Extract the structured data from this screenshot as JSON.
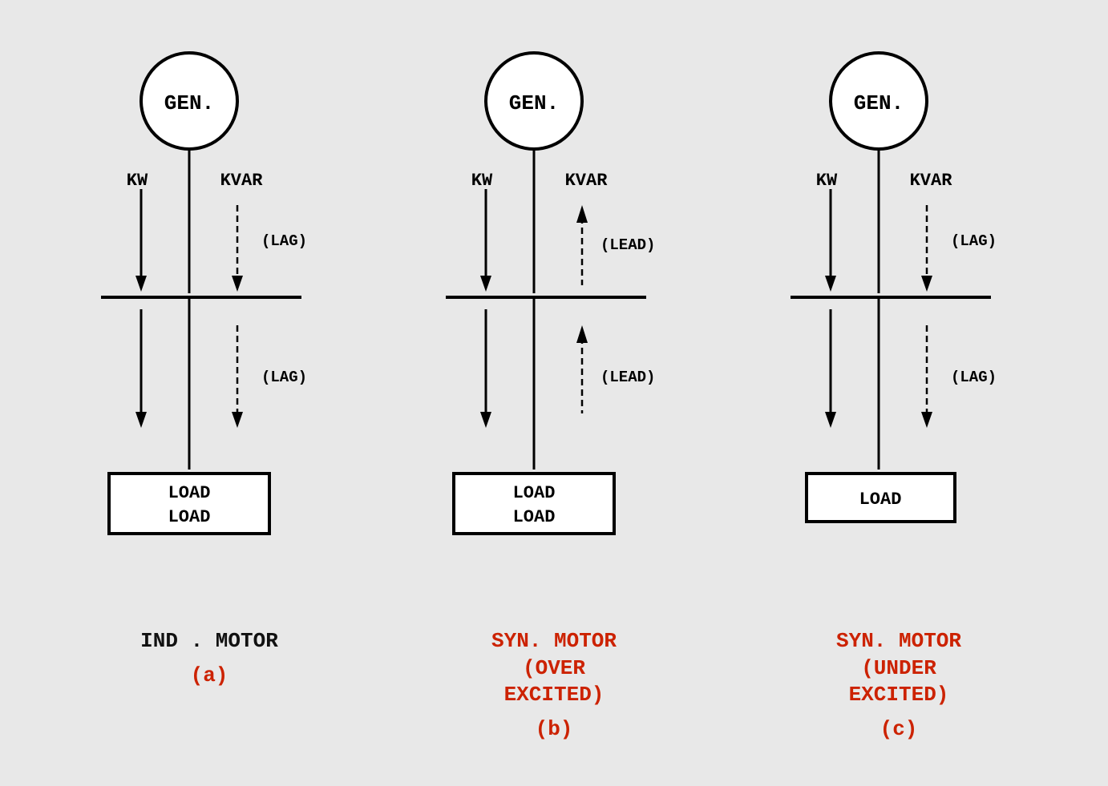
{
  "diagrams": [
    {
      "id": "a",
      "gen_label": "GEN.",
      "kw_label": "KW",
      "kvar_label": "KVAR",
      "kvar_direction_top": "down",
      "kvar_annotation_top": "(LAG)",
      "kvar_direction_bottom": "down",
      "kvar_annotation_bottom": "(LAG)",
      "kw_solid_top": true,
      "kvar_solid_top": false,
      "kw_solid_bottom": true,
      "kvar_solid_bottom": false,
      "load_label": "LOAD\nLOAD",
      "title": "IND . MOTOR",
      "title_color": "black",
      "sub_label": "(a)",
      "sub_color": "red"
    },
    {
      "id": "b",
      "gen_label": "GEN.",
      "kw_label": "KW",
      "kvar_label": "KVAR",
      "kvar_direction_top": "up",
      "kvar_annotation_top": "(LEAD)",
      "kvar_direction_bottom": "up",
      "kvar_annotation_bottom": "(LEAD)",
      "kw_solid_top": true,
      "kvar_solid_top": false,
      "kw_solid_bottom": true,
      "kvar_solid_bottom": false,
      "load_label": "LOAD\nLOAD",
      "title": "SYN. MOTOR\n(OVER\nEXCITED)",
      "title_color": "red",
      "sub_label": "(b)",
      "sub_color": "red"
    },
    {
      "id": "c",
      "gen_label": "GEN.",
      "kw_label": "KW",
      "kvar_label": "KVAR",
      "kvar_direction_top": "down",
      "kvar_annotation_top": "(LAG)",
      "kvar_direction_bottom": "down",
      "kvar_annotation_bottom": "(LAG)",
      "kw_solid_top": true,
      "kvar_solid_top": false,
      "kw_solid_bottom": true,
      "kvar_solid_bottom": false,
      "load_label": "LOAD",
      "title": "SYN. MOTOR\n(UNDER\nEXCITED)",
      "title_color": "red",
      "sub_label": "(c)",
      "sub_color": "red"
    }
  ]
}
